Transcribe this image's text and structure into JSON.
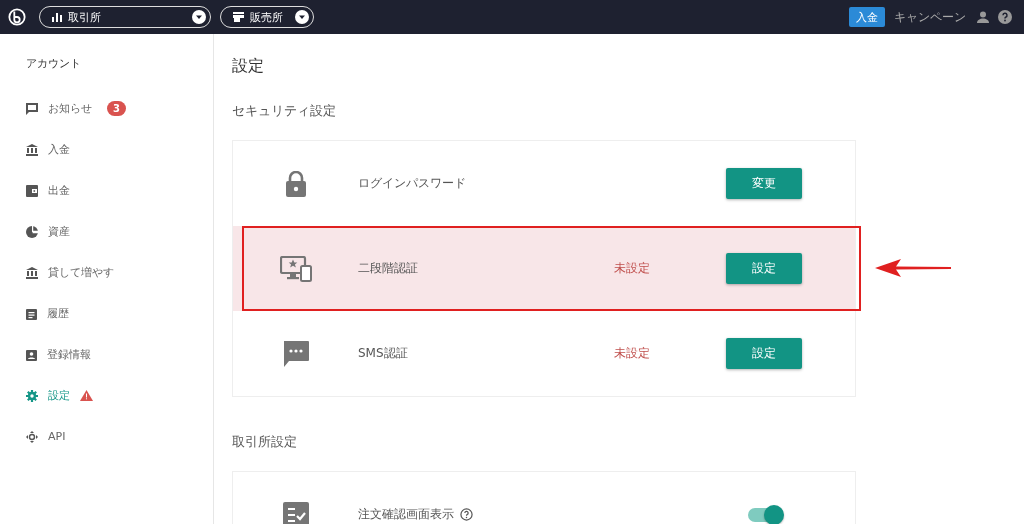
{
  "topbar": {
    "dropdowns": [
      {
        "kind": "chart",
        "label": "取引所"
      },
      {
        "kind": "store",
        "label": "販売所"
      }
    ],
    "deposit_button": "入金",
    "campaign_link": "キャンペーン"
  },
  "sidebar": {
    "heading": "アカウント",
    "items": [
      {
        "kind": "message",
        "label": "お知らせ",
        "badge": "3",
        "selected": false,
        "warning": false
      },
      {
        "kind": "bank",
        "label": "入金",
        "selected": false,
        "warning": false
      },
      {
        "kind": "wallet",
        "label": "出金",
        "selected": false,
        "warning": false
      },
      {
        "kind": "pie",
        "label": "資産",
        "selected": false,
        "warning": false
      },
      {
        "kind": "bank",
        "label": "貸して増やす",
        "selected": false,
        "warning": false
      },
      {
        "kind": "clipboard",
        "label": "履歴",
        "selected": false,
        "warning": false
      },
      {
        "kind": "badge",
        "label": "登録情報",
        "selected": false,
        "warning": false
      },
      {
        "kind": "gear",
        "label": "設定",
        "selected": true,
        "warning": true
      },
      {
        "kind": "api",
        "label": "API",
        "selected": false,
        "warning": false
      }
    ]
  },
  "page_title": "設定",
  "sections": [
    {
      "title": "セキュリティ設定",
      "rows": [
        {
          "kind": "lock",
          "label": "ログインパスワード",
          "highlighted": false,
          "button": "変更"
        },
        {
          "kind": "devices",
          "label": "二段階認証",
          "status": "未設定",
          "highlighted": true,
          "button": "設定"
        },
        {
          "kind": "sms",
          "label": "SMS認証",
          "status": "未設定",
          "highlighted": false,
          "button": "設定"
        }
      ]
    },
    {
      "title": "取引所設定",
      "rows": [
        {
          "kind": "checklist",
          "label": "注文確認画面表示",
          "help": true,
          "highlighted": false,
          "toggle": {
            "on": true
          }
        }
      ]
    }
  ]
}
